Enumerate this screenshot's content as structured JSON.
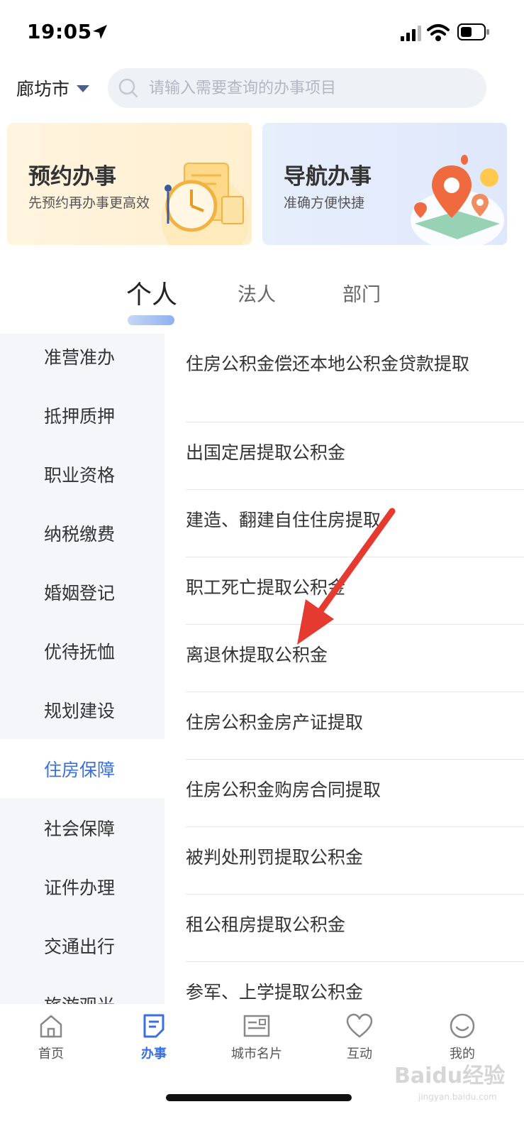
{
  "status_bar": {
    "time": "19:05"
  },
  "header": {
    "city": "廊坊市",
    "search_placeholder": "请输入需要查询的办事项目"
  },
  "cards": {
    "appoint": {
      "title": "预约办事",
      "subtitle": "先预约再办事更高效"
    },
    "navigate": {
      "title": "导航办事",
      "subtitle": "准确方便快捷"
    }
  },
  "tabs": {
    "personal": "个人",
    "legal": "法人",
    "department": "部门",
    "active": "个人"
  },
  "sidebar": {
    "active": "住房保障",
    "items": [
      {
        "label": "准营准办"
      },
      {
        "label": "抵押质押"
      },
      {
        "label": "职业资格"
      },
      {
        "label": "纳税缴费"
      },
      {
        "label": "婚姻登记"
      },
      {
        "label": "优待抚恤"
      },
      {
        "label": "规划建设"
      },
      {
        "label": "住房保障"
      },
      {
        "label": "社会保障"
      },
      {
        "label": "证件办理"
      },
      {
        "label": "交通出行"
      },
      {
        "label": "旅游观光"
      }
    ]
  },
  "services": {
    "items": [
      {
        "label": "住房公积金偿还本地公积金贷款提取"
      },
      {
        "label": "出国定居提取公积金"
      },
      {
        "label": "建造、翻建自住住房提取"
      },
      {
        "label": "职工死亡提取公积金"
      },
      {
        "label": "离退休提取公积金"
      },
      {
        "label": "住房公积金房产证提取"
      },
      {
        "label": "住房公积金购房合同提取"
      },
      {
        "label": "被判处刑罚提取公积金"
      },
      {
        "label": "租公租房提取公积金"
      },
      {
        "label": "参军、上学提取公积金"
      }
    ]
  },
  "tabbar": {
    "active": "办事",
    "items": [
      {
        "label": "首页",
        "icon": "home-icon"
      },
      {
        "label": "办事",
        "icon": "document-icon"
      },
      {
        "label": "城市名片",
        "icon": "city-card-icon"
      },
      {
        "label": "互动",
        "icon": "heart-icon"
      },
      {
        "label": "我的",
        "icon": "smile-icon"
      }
    ]
  },
  "watermark": {
    "brand": "Baidu经验",
    "url": "jingyan.baidu.com"
  },
  "colors": {
    "accent": "#3a6fe0",
    "sidebar_bg": "#f5f6f9",
    "arrow": "#e53a2f"
  }
}
